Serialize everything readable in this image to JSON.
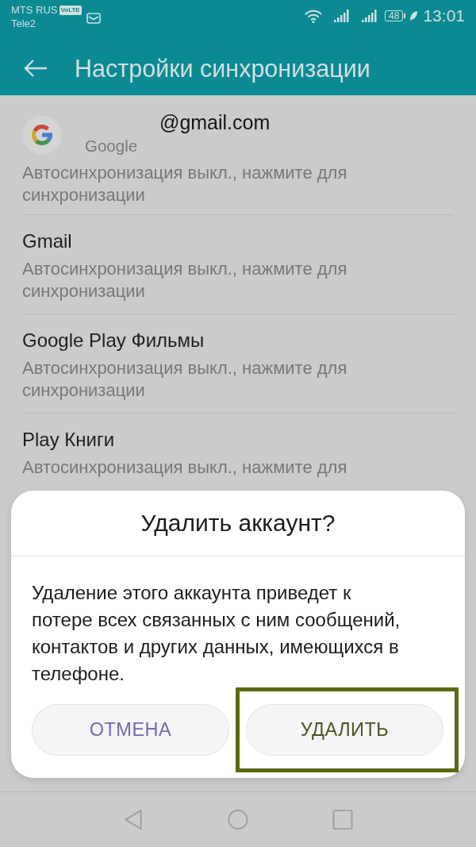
{
  "status_bar": {
    "carrier_1": "MTS RUS",
    "volte_badge": "VoLTE",
    "carrier_2": "Tele2",
    "battery": "48",
    "time": "13:01"
  },
  "app_bar": {
    "title": "Настройки синхронизации"
  },
  "account": {
    "email": "@gmail.com",
    "type": "Google"
  },
  "sync_items": [
    {
      "subtitle": "Автосинхронизация выкл., нажмите для синхронизации"
    },
    {
      "title": "Gmail",
      "subtitle": "Автосинхронизация выкл., нажмите для синхронизации"
    },
    {
      "title": "Google Play Фильмы",
      "subtitle": "Автосинхронизация выкл., нажмите для синхронизации"
    },
    {
      "title": "Play Книги",
      "subtitle": "Автосинхронизация выкл., нажмите для"
    }
  ],
  "dialog": {
    "title": "Удалить аккаунт?",
    "message": "Удаление этого аккаунта приведет к потере всех связанных с ним сообщений, контактов и других данных, имеющихся в телефоне.",
    "buttons": [
      {
        "label": "ОТМЕНА",
        "highlighted": false
      },
      {
        "label": "УДАЛИТЬ",
        "highlighted": true
      }
    ]
  }
}
